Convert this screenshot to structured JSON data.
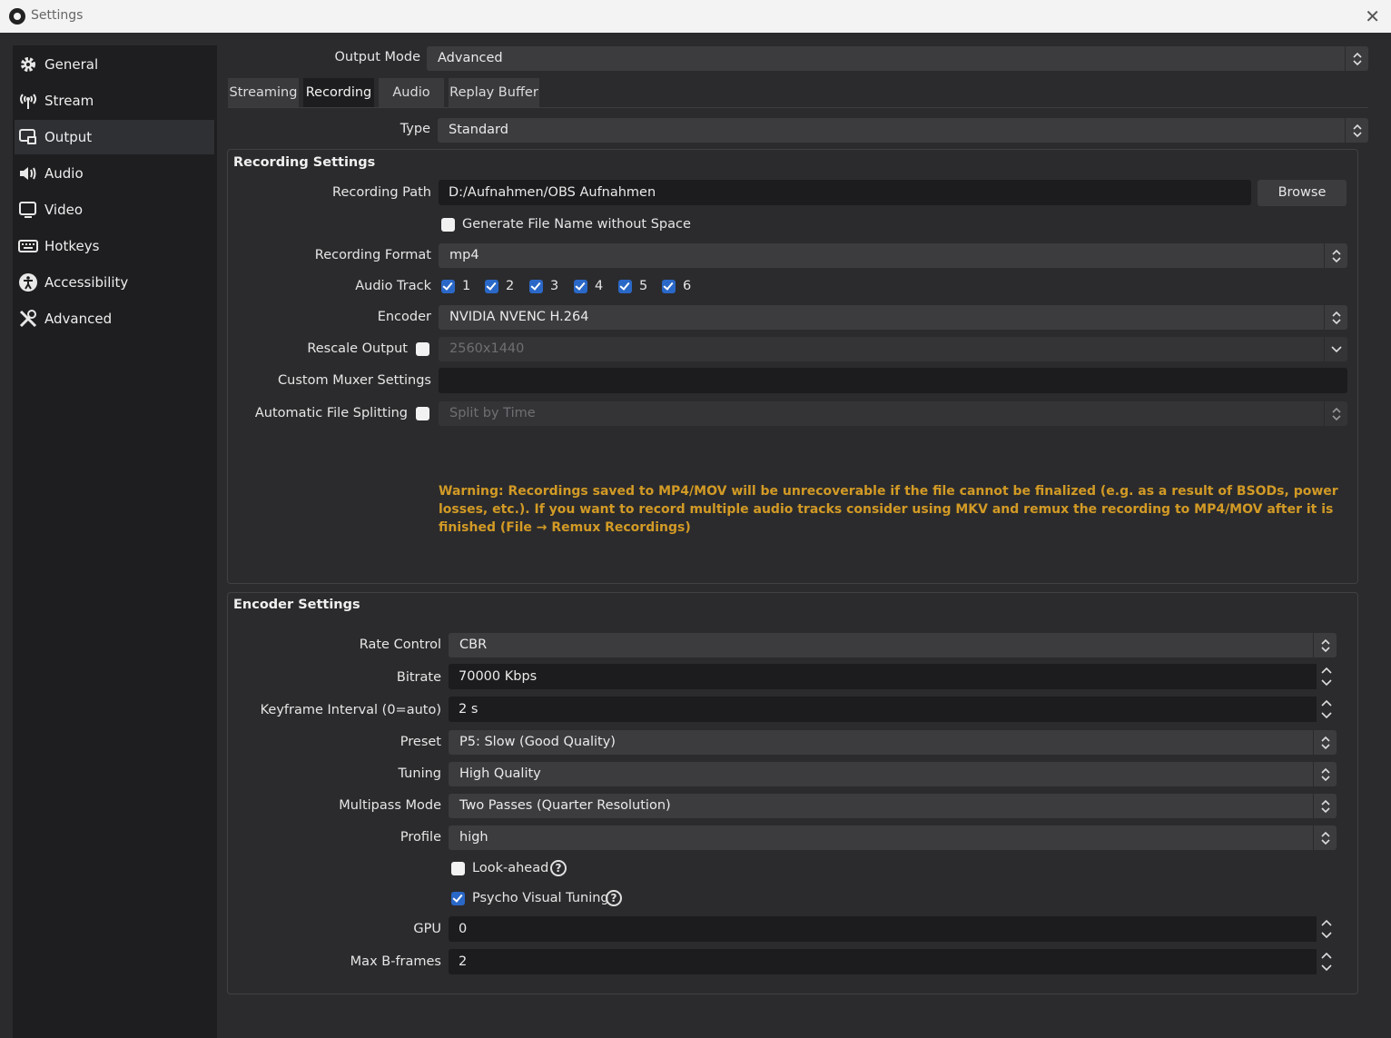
{
  "window": {
    "title": "Settings"
  },
  "sidebar": {
    "items": [
      {
        "label": "General",
        "icon": "gear-icon"
      },
      {
        "label": "Stream",
        "icon": "antenna-icon"
      },
      {
        "label": "Output",
        "icon": "output-icon"
      },
      {
        "label": "Audio",
        "icon": "speaker-icon"
      },
      {
        "label": "Video",
        "icon": "monitor-icon"
      },
      {
        "label": "Hotkeys",
        "icon": "keyboard-icon"
      },
      {
        "label": "Accessibility",
        "icon": "accessibility-icon"
      },
      {
        "label": "Advanced",
        "icon": "tools-icon"
      }
    ],
    "active": "Output"
  },
  "output_mode": {
    "label": "Output Mode",
    "value": "Advanced"
  },
  "tabs": [
    "Streaming",
    "Recording",
    "Audio",
    "Replay Buffer"
  ],
  "active_tab": "Recording",
  "type": {
    "label": "Type",
    "value": "Standard"
  },
  "recording_settings": {
    "title": "Recording Settings",
    "path_label": "Recording Path",
    "path_value": "D:/Aufnahmen/OBS Aufnahmen",
    "browse_label": "Browse",
    "gen_file_name_label": "Generate File Name without Space",
    "gen_file_name_checked": false,
    "format_label": "Recording Format",
    "format_value": "mp4",
    "audio_track_label": "Audio Track",
    "audio_tracks": [
      "1",
      "2",
      "3",
      "4",
      "5",
      "6"
    ],
    "encoder_label": "Encoder",
    "encoder_value": "NVIDIA NVENC H.264",
    "rescale_label": "Rescale Output",
    "rescale_checked": false,
    "rescale_value": "2560x1440",
    "muxer_label": "Custom Muxer Settings",
    "muxer_value": "",
    "splitting_label": "Automatic File Splitting",
    "splitting_checked": false,
    "splitting_value": "Split by Time",
    "warning": "Warning: Recordings saved to MP4/MOV will be unrecoverable if the file cannot be finalized (e.g. as a result of BSODs, power losses, etc.). If you want to record multiple audio tracks consider using MKV and remux the recording to MP4/MOV after it is finished (File → Remux Recordings)"
  },
  "encoder_settings": {
    "title": "Encoder Settings",
    "rate_control_label": "Rate Control",
    "rate_control_value": "CBR",
    "bitrate_label": "Bitrate",
    "bitrate_value": "70000 Kbps",
    "keyframe_label": "Keyframe Interval (0=auto)",
    "keyframe_value": "2 s",
    "preset_label": "Preset",
    "preset_value": "P5: Slow (Good Quality)",
    "tuning_label": "Tuning",
    "tuning_value": "High Quality",
    "multipass_label": "Multipass Mode",
    "multipass_value": "Two Passes (Quarter Resolution)",
    "profile_label": "Profile",
    "profile_value": "high",
    "lookahead_label": "Look-ahead",
    "lookahead_checked": false,
    "psycho_label": "Psycho Visual Tuning",
    "psycho_checked": true,
    "gpu_label": "GPU",
    "gpu_value": "0",
    "bframes_label": "Max B-frames",
    "bframes_value": "2"
  },
  "colors": {
    "warning": "#d29a25",
    "accent": "#2a68c7",
    "sidebar_bg": "#1e1e20",
    "content_bg": "#2b2b2d"
  }
}
